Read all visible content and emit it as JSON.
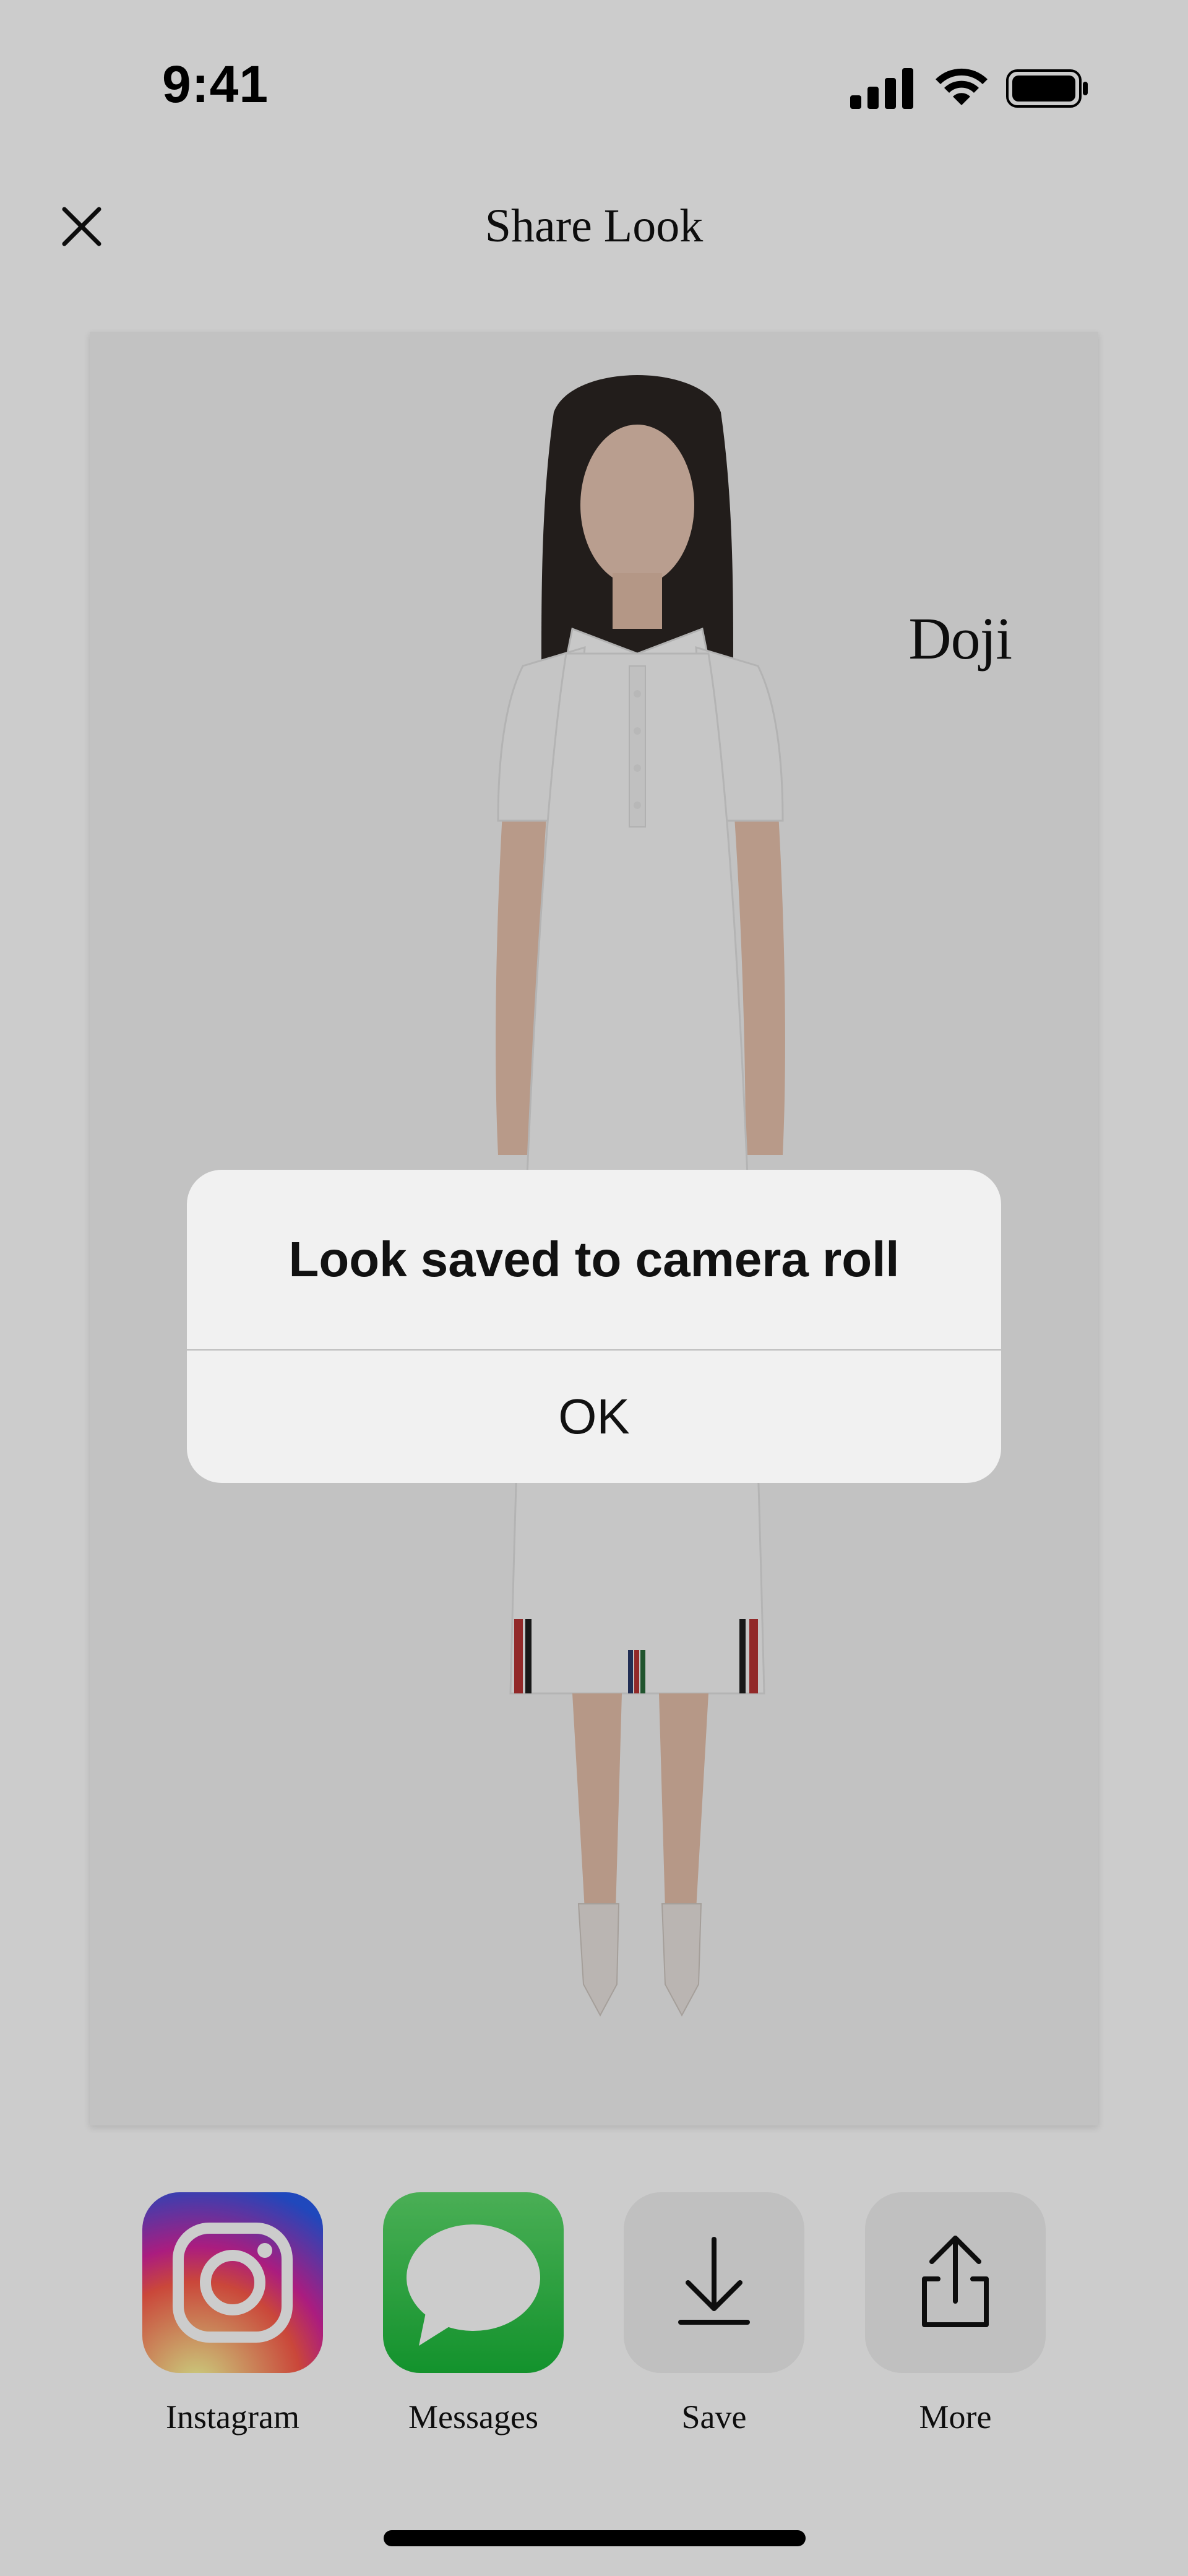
{
  "status_bar": {
    "time": "9:41",
    "icons": [
      "signal-icon",
      "wifi-icon",
      "battery-icon"
    ]
  },
  "header": {
    "title": "Share Look",
    "close_icon": "close-icon"
  },
  "look": {
    "brand": "Doji",
    "image": "model-in-white-polo-dress"
  },
  "share_options": [
    {
      "label": "Instagram",
      "icon": "instagram-icon"
    },
    {
      "label": "Messages",
      "icon": "messages-icon"
    },
    {
      "label": "Save",
      "icon": "download-icon"
    },
    {
      "label": "More",
      "icon": "share-icon"
    }
  ],
  "alert": {
    "title": "Look saved to camera roll",
    "ok_label": "OK"
  },
  "colors": {
    "overlay": "rgba(0,0,0,0.20)",
    "messages_green": "#2fc244",
    "alert_bg": "#f1f1f1"
  }
}
